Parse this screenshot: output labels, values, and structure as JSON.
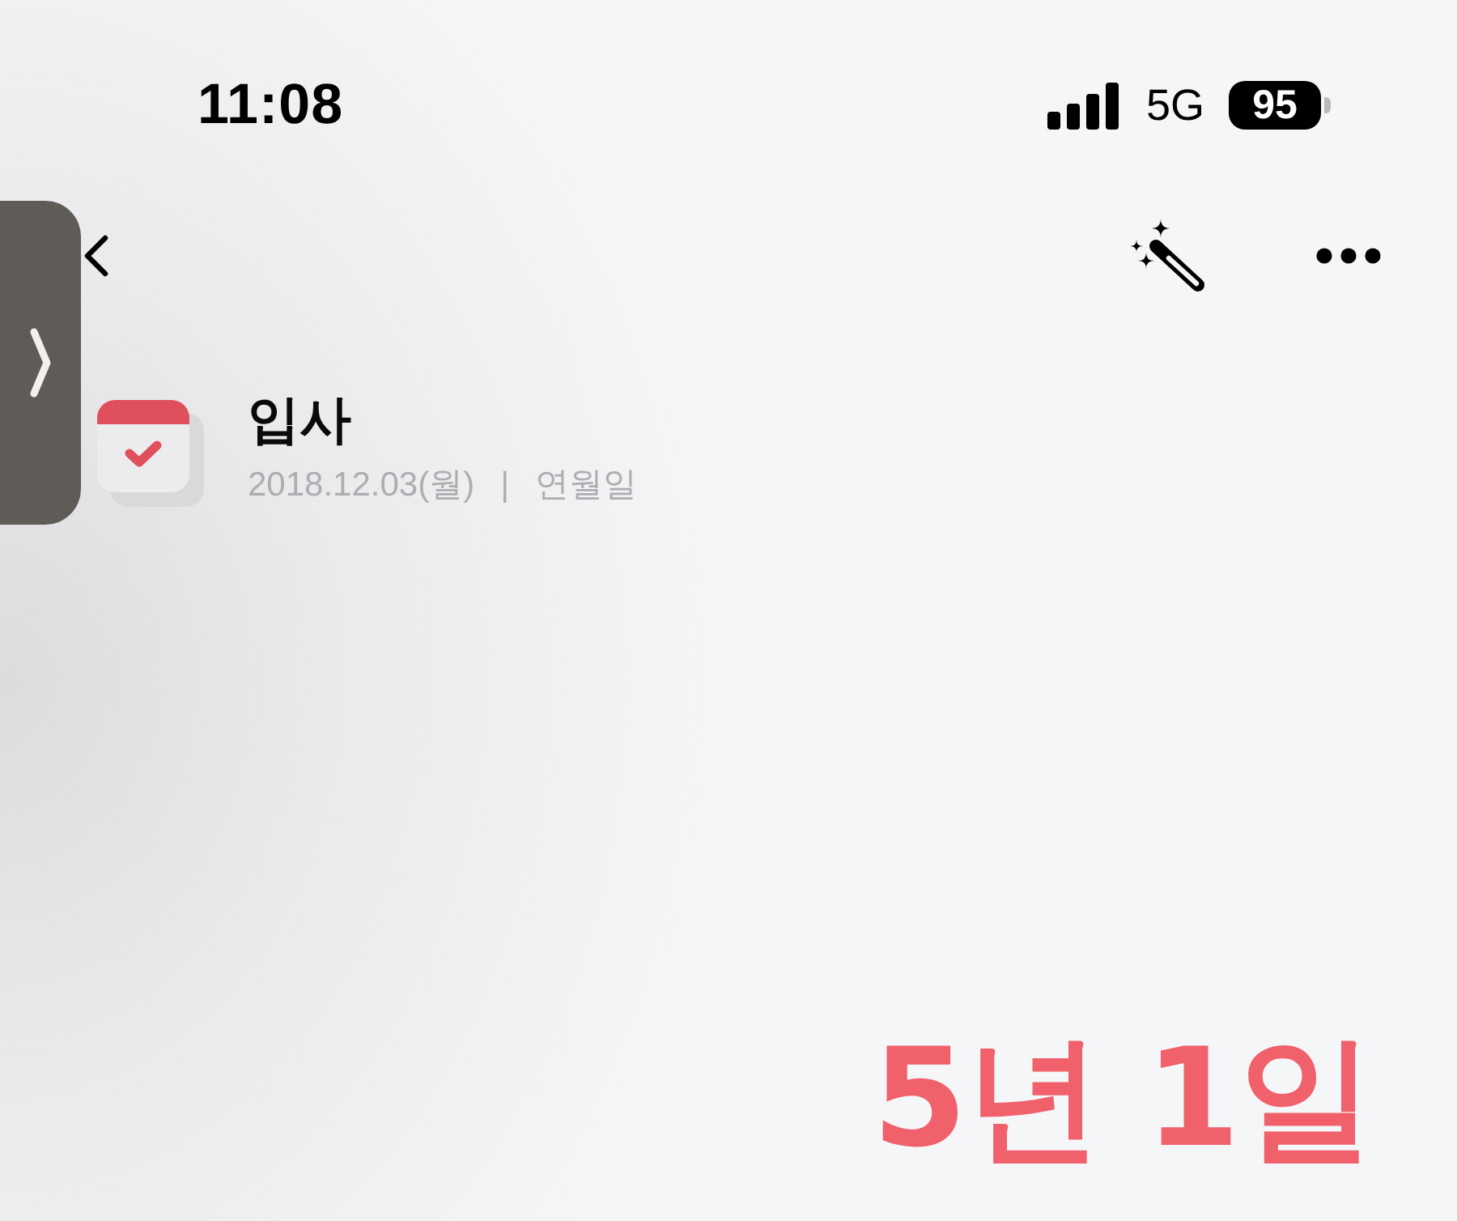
{
  "status_bar": {
    "time": "11:08",
    "network": "5G",
    "battery": "95"
  },
  "event": {
    "title": "입사",
    "date": "2018.12.03(월)",
    "separator": "|",
    "format": "연월일"
  },
  "elapsed": "5년 1일"
}
